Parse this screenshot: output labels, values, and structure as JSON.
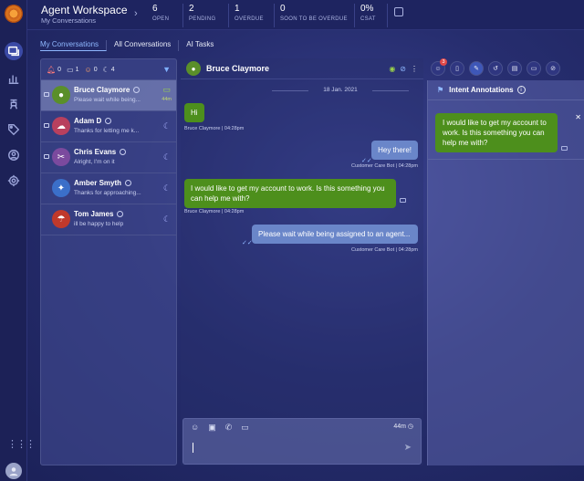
{
  "header": {
    "title": "Agent Workspace",
    "subtitle": "My Conversations",
    "stats": [
      {
        "value": "6",
        "label": "OPEN"
      },
      {
        "value": "2",
        "label": "PENDING"
      },
      {
        "value": "1",
        "label": "OVERDUE"
      },
      {
        "value": "0",
        "label": "SOON TO BE OVERDUE"
      },
      {
        "value": "0%",
        "label": "CSAT"
      }
    ]
  },
  "tabs": [
    {
      "label": "My Conversations"
    },
    {
      "label": "All Conversations"
    },
    {
      "label": "AI Tasks"
    }
  ],
  "counters": {
    "alerts": "0",
    "messages": "1",
    "users": "0",
    "waiting": "4"
  },
  "conversations": [
    {
      "name": "Bruce Claymore",
      "preview": "Please wait while being...",
      "time": "44m",
      "avatar_color": "#5a8f2a"
    },
    {
      "name": "Adam D",
      "preview": "Thanks for letting me k...",
      "avatar_color": "#b8405e"
    },
    {
      "name": "Chris Evans",
      "preview": "Alright, I'm on it",
      "avatar_color": "#7b4a9e"
    },
    {
      "name": "Amber Smyth",
      "preview": "Thanks for approaching...",
      "avatar_color": "#3b6fc9"
    },
    {
      "name": "Tom James",
      "preview": "ill be happy to help",
      "avatar_color": "#c0392b"
    }
  ],
  "chat": {
    "contact": "Bruce Claymore",
    "date": "18 Jan. 2021",
    "messages": [
      {
        "text": "Hi",
        "meta": "Bruce Claymore  |  04:28pm"
      },
      {
        "text": "Hey there!",
        "meta": "Customer Care Bot  |  04:28pm"
      },
      {
        "text": "I would like to get my account to work. Is this something you can help me with?",
        "meta": "Bruce Claymore  |  04:28pm"
      },
      {
        "text": "Please wait while being assigned to an agent...",
        "meta": "Customer Care Bot  |  04:28pm"
      }
    ],
    "timer": "44m"
  },
  "right_panel": {
    "title": "Intent Annotations",
    "annotation": "I would like to get my account to work. Is this something you can help me with?",
    "badge": "3"
  }
}
